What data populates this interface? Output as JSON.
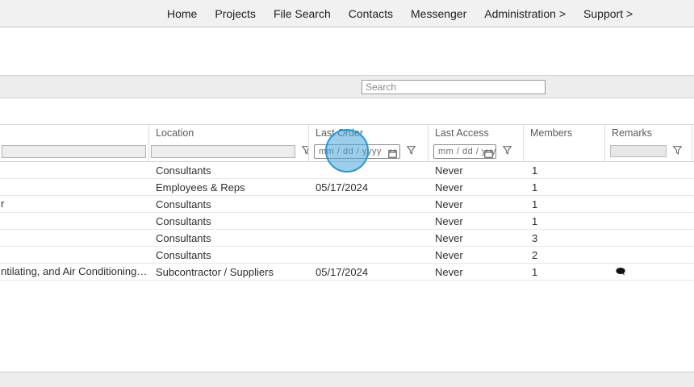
{
  "nav": {
    "items": [
      "Home",
      "Projects",
      "File Search",
      "Contacts",
      "Messenger",
      "Administration >",
      "Support >"
    ]
  },
  "search": {
    "placeholder": "Search"
  },
  "table": {
    "columns": [
      "",
      "Location",
      "Last Order",
      "Last Access",
      "Members",
      "Remarks"
    ],
    "filters": {
      "date_placeholder": "mm / dd / yyyy"
    },
    "rows": [
      {
        "name": "",
        "location": "Consultants",
        "last_order": "",
        "last_access": "Never",
        "members": "1"
      },
      {
        "name": "",
        "location": "Employees & Reps",
        "last_order": "05/17/2024",
        "last_access": "Never",
        "members": "1"
      },
      {
        "name": "r",
        "location": "Consultants",
        "last_order": "",
        "last_access": "Never",
        "members": "1"
      },
      {
        "name": "",
        "location": "Consultants",
        "last_order": "",
        "last_access": "Never",
        "members": "1"
      },
      {
        "name": "",
        "location": "Consultants",
        "last_order": "",
        "last_access": "Never",
        "members": "3"
      },
      {
        "name": "",
        "location": "Consultants",
        "last_order": "",
        "last_access": "Never",
        "members": "2"
      },
      {
        "name": "ntilating, and Air Conditioning (…",
        "location": "Subcontractor / Suppliers",
        "last_order": "05/17/2024",
        "last_access": "Never",
        "members": "1"
      }
    ]
  }
}
